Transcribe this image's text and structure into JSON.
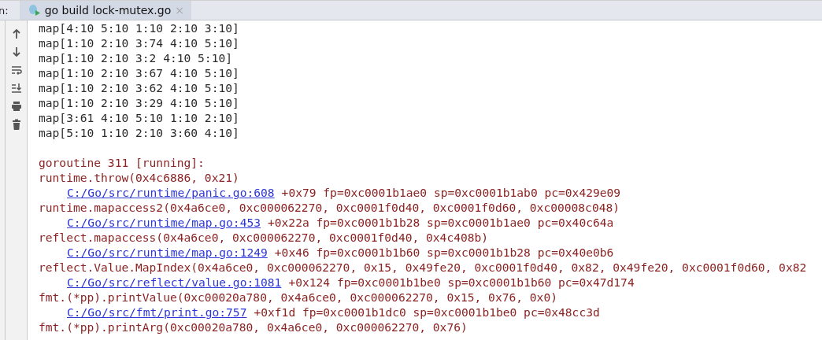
{
  "tool_window": {
    "label": "n:",
    "tabs": [
      {
        "title": "go build lock-mutex.go",
        "selected": true,
        "close": "×"
      }
    ]
  },
  "toolbar": [
    {
      "kind": "up"
    },
    {
      "kind": "down"
    },
    {
      "kind": "wrap"
    },
    {
      "kind": "scroll-end"
    },
    {
      "kind": "print"
    },
    {
      "kind": "trash"
    }
  ],
  "console": [
    {
      "kind": "stdout",
      "text": "map[4:10 5:10 1:10 2:10 3:10]"
    },
    {
      "kind": "stdout",
      "text": "map[1:10 2:10 3:74 4:10 5:10]"
    },
    {
      "kind": "stdout",
      "text": "map[1:10 2:10 3:2 4:10 5:10]"
    },
    {
      "kind": "stdout",
      "text": "map[1:10 2:10 3:67 4:10 5:10]"
    },
    {
      "kind": "stdout",
      "text": "map[1:10 2:10 3:62 4:10 5:10]"
    },
    {
      "kind": "stdout",
      "text": "map[1:10 2:10 3:29 4:10 5:10]"
    },
    {
      "kind": "stdout",
      "text": "map[3:61 4:10 5:10 1:10 2:10]"
    },
    {
      "kind": "stdout",
      "text": "map[5:10 1:10 2:10 3:60 4:10]"
    },
    {
      "kind": "blank"
    },
    {
      "kind": "stderr",
      "text": "goroutine 311 [running]:"
    },
    {
      "kind": "stderr",
      "text": "runtime.throw(0x4c6886, 0x21)"
    },
    {
      "kind": "frame",
      "link": "C:/Go/src/runtime/panic.go:608",
      "text": "+0x79 fp=0xc0001b1ae0 sp=0xc0001b1ab0 pc=0x429e09"
    },
    {
      "kind": "stderr",
      "text": "runtime.mapaccess2(0x4a6ce0, 0xc000062270, 0xc0001f0d40, 0xc0001f0d60, 0xc00008c048)"
    },
    {
      "kind": "frame",
      "link": "C:/Go/src/runtime/map.go:453",
      "text": "+0x22a fp=0xc0001b1b28 sp=0xc0001b1ae0 pc=0x40c64a"
    },
    {
      "kind": "stderr",
      "text": "reflect.mapaccess(0x4a6ce0, 0xc000062270, 0xc0001f0d40, 0x4c408b)"
    },
    {
      "kind": "frame",
      "link": "C:/Go/src/runtime/map.go:1249",
      "text": "+0x46 fp=0xc0001b1b60 sp=0xc0001b1b28 pc=0x40e0b6"
    },
    {
      "kind": "stderr",
      "text": "reflect.Value.MapIndex(0x4a6ce0, 0xc000062270, 0x15, 0x49fe20, 0xc0001f0d40, 0x82, 0x49fe20, 0xc0001f0d60, 0x82"
    },
    {
      "kind": "frame",
      "link": "C:/Go/src/reflect/value.go:1081",
      "text": "+0x124 fp=0xc0001b1be0 sp=0xc0001b1b60 pc=0x47d174"
    },
    {
      "kind": "stderr",
      "text": "fmt.(*pp).printValue(0xc00020a780, 0x4a6ce0, 0xc000062270, 0x15, 0x76, 0x0)"
    },
    {
      "kind": "frame",
      "link": "C:/Go/src/fmt/print.go:757",
      "text": "+0xf1d fp=0xc0001b1dc0 sp=0xc0001b1be0 pc=0x48cc3d"
    },
    {
      "kind": "stderr",
      "text": "fmt.(*pp).printArg(0xc00020a780, 0x4a6ce0, 0xc000062270, 0x76)"
    }
  ]
}
